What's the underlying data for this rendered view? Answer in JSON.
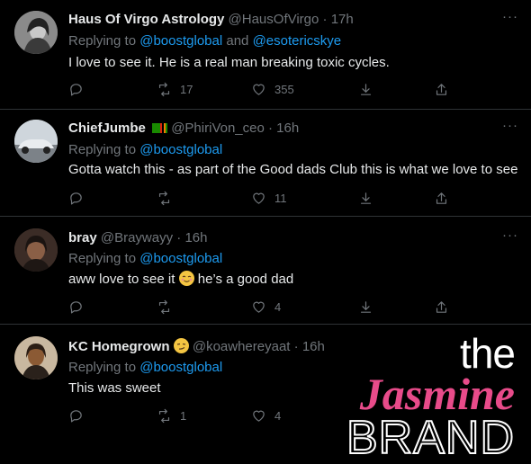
{
  "tweets": [
    {
      "name": "Haus Of Virgo Astrology",
      "handle": "@HausOfVirgo",
      "time": "17h",
      "replying_prefix": "Replying to",
      "mention1": "@boostglobal",
      "conj": "and",
      "mention2": "@esotericskye",
      "text": "I love to see it. He is a real man breaking toxic cycles.",
      "retweets": "17",
      "likes": "355",
      "avatar_color": "#6b6b6b"
    },
    {
      "name": "ChiefJumbe",
      "handle": "@PhiriVon_ceo",
      "time": "16h",
      "replying_prefix": "Replying to",
      "mention1": "@boostglobal",
      "text": "Gotta watch this - as part of the Good dads Club this is what we love to see",
      "retweets": "",
      "likes": "11",
      "avatar_color": "#9aa3ab"
    },
    {
      "name": "bray",
      "handle": "@Braywayy",
      "time": "16h",
      "replying_prefix": "Replying to",
      "mention1": "@boostglobal",
      "text_before": "aww love to see it",
      "text_after": "he’s a good dad",
      "retweets": "",
      "likes": "4",
      "avatar_color": "#5a4438"
    },
    {
      "name": "KC Homegrown",
      "handle": "@koawhereyaat",
      "time": "16h",
      "replying_prefix": "Replying to",
      "mention1": "@boostglobal",
      "text": "This was sweet",
      "retweets": "1",
      "likes": "4",
      "avatar_color": "#7a5a3a"
    }
  ],
  "more_label": "···",
  "dot": "·",
  "watermark": {
    "the": "the",
    "jasmine": "Jasmine",
    "brand": "BRAND"
  },
  "colors": {
    "background": "#000000",
    "accent": "#1d9bf0",
    "muted": "#71767b",
    "divider": "#2f3336",
    "watermark_pink": "#e84b8a"
  }
}
